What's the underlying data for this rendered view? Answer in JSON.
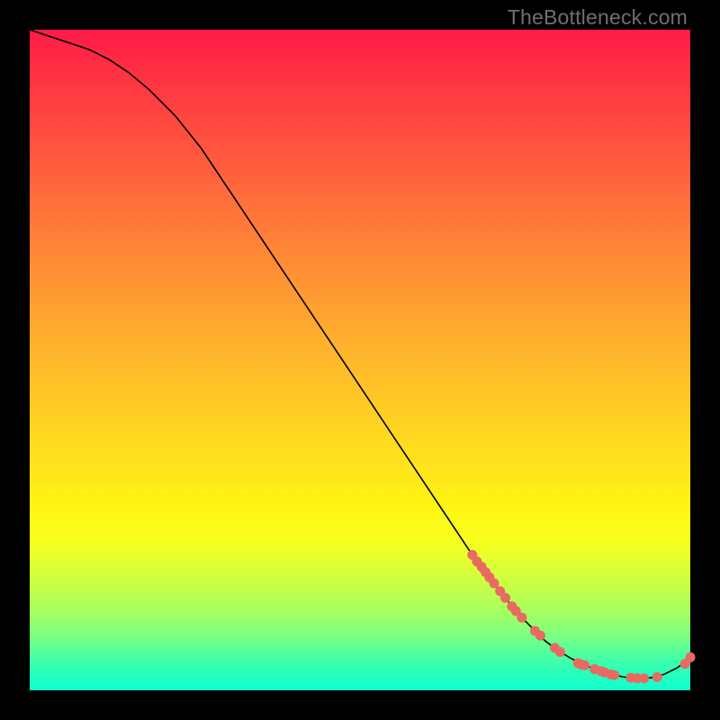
{
  "attribution": "TheBottleneck.com",
  "colors": {
    "bg": "#000000",
    "line": "#000000",
    "marker": "#e86a63",
    "attribution_text": "#6f6f6f"
  },
  "chart_data": {
    "type": "line",
    "title": "",
    "xlabel": "",
    "ylabel": "",
    "xlim": [
      0,
      100
    ],
    "ylim": [
      0,
      100
    ],
    "grid": false,
    "legend": false,
    "series": [
      {
        "name": "bottleneck-curve",
        "x": [
          0,
          3,
          6,
          9,
          12,
          15,
          18,
          22,
          26,
          30,
          35,
          40,
          45,
          50,
          55,
          60,
          64,
          66,
          68,
          70,
          72,
          74,
          76,
          78,
          80,
          82,
          84,
          86,
          88,
          90,
          92,
          94,
          96,
          98,
          100
        ],
        "values": [
          100,
          99,
          98,
          97,
          95.5,
          93.5,
          91,
          87,
          82,
          76,
          68.5,
          61,
          53.5,
          46,
          38.5,
          31,
          25,
          22,
          19,
          16.5,
          14,
          11.5,
          9.5,
          7.5,
          6,
          4.8,
          3.8,
          3.0,
          2.4,
          2.0,
          1.8,
          1.9,
          2.4,
          3.4,
          4.8
        ]
      }
    ],
    "markers": [
      {
        "x": 67.0,
        "y": 20.5
      },
      {
        "x": 67.7,
        "y": 19.5
      },
      {
        "x": 68.4,
        "y": 18.7
      },
      {
        "x": 69.0,
        "y": 17.9
      },
      {
        "x": 69.6,
        "y": 17.1
      },
      {
        "x": 70.3,
        "y": 16.2
      },
      {
        "x": 71.2,
        "y": 15.0
      },
      {
        "x": 72.0,
        "y": 14.0
      },
      {
        "x": 73.0,
        "y": 12.7
      },
      {
        "x": 73.6,
        "y": 12.0
      },
      {
        "x": 74.5,
        "y": 11.0
      },
      {
        "x": 76.5,
        "y": 9.0
      },
      {
        "x": 77.3,
        "y": 8.3
      },
      {
        "x": 79.5,
        "y": 6.4
      },
      {
        "x": 80.3,
        "y": 5.8
      },
      {
        "x": 83.0,
        "y": 4.1
      },
      {
        "x": 83.5,
        "y": 3.9
      },
      {
        "x": 84.0,
        "y": 3.8
      },
      {
        "x": 85.5,
        "y": 3.2
      },
      {
        "x": 86.5,
        "y": 2.9
      },
      {
        "x": 87.0,
        "y": 2.7
      },
      {
        "x": 88.0,
        "y": 2.4
      },
      {
        "x": 88.5,
        "y": 2.3
      },
      {
        "x": 91.0,
        "y": 1.9
      },
      {
        "x": 92.0,
        "y": 1.8
      },
      {
        "x": 93.0,
        "y": 1.8
      },
      {
        "x": 95.0,
        "y": 2.0
      },
      {
        "x": 99.2,
        "y": 4.0
      },
      {
        "x": 100.0,
        "y": 5.0
      }
    ]
  }
}
